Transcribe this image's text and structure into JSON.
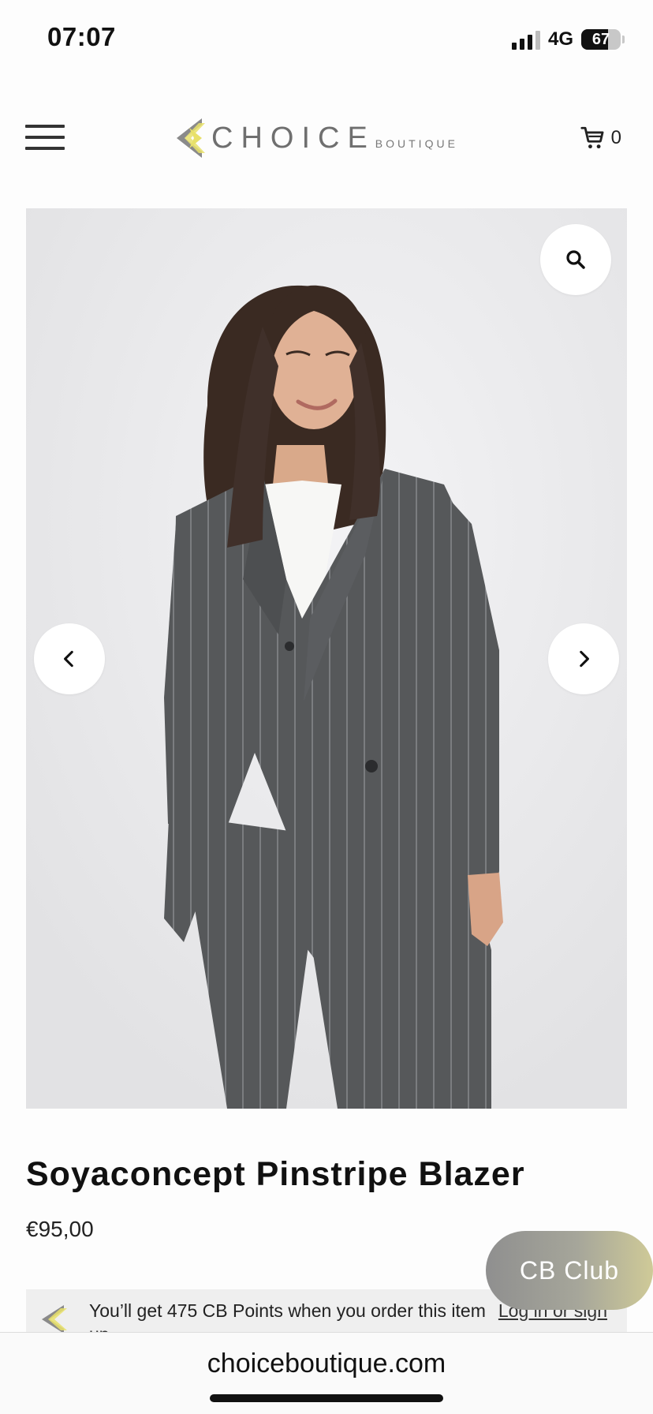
{
  "status_bar": {
    "time": "07:07",
    "network": "4G",
    "battery_percent": "67",
    "battery_level": 0.67
  },
  "header": {
    "menu_icon": "hamburger-menu-icon",
    "logo": {
      "word": "CHOICE",
      "sub": "BOUTIQUE",
      "accent_color": "#e8e06a"
    },
    "cart_icon": "shopping-cart-icon",
    "cart_count": "0"
  },
  "gallery": {
    "zoom_icon": "magnifier-icon",
    "prev_icon": "chevron-left-icon",
    "next_icon": "chevron-right-icon"
  },
  "product": {
    "title": "Soyaconcept Pinstripe Blazer",
    "price": "€95,00"
  },
  "club_button": {
    "label": "CB Club"
  },
  "points": {
    "text": "You’ll get 475 CB Points when you order this item",
    "link": "Log in or sign up"
  },
  "browser": {
    "url": "choiceboutique.com"
  }
}
